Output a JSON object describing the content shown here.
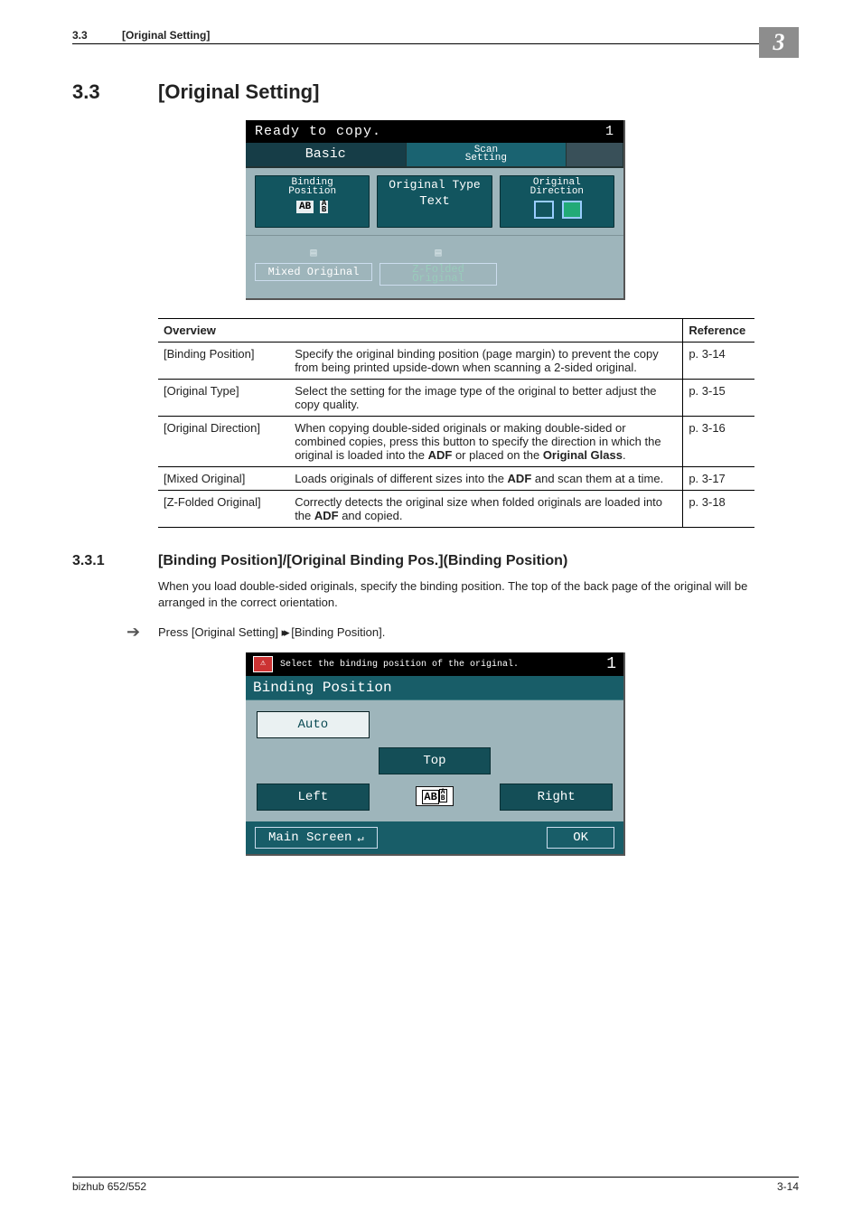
{
  "header": {
    "sec_num": "3.3",
    "sec_title": "[Original Setting]",
    "chapter": "3"
  },
  "heading": {
    "num": "3.3",
    "title": "[Original Setting]"
  },
  "panel1": {
    "status": "Ready to copy.",
    "count": "1",
    "tab_basic": "Basic",
    "tab_scan1": "Scan",
    "tab_scan2": "Setting",
    "binding_pos1": "Binding",
    "binding_pos2": "Position",
    "binding_icon": "AB A/B",
    "orig_type_label": "Original Type",
    "orig_type_value": "Text",
    "orig_dir1": "Original",
    "orig_dir2": "Direction",
    "mixed": "Mixed Original",
    "zfold1": "Z-Folded",
    "zfold2": "Original"
  },
  "table": {
    "h1": "Overview",
    "h2": "Reference",
    "rows": [
      {
        "name": "[Binding Position]",
        "desc": "Specify the original binding position (page margin) to prevent the copy from being printed upside-down when scanning a 2-sided original.",
        "ref": "p. 3-14"
      },
      {
        "name": "[Original Type]",
        "desc": "Select the setting for the image type of the original to better adjust the copy quality.",
        "ref": "p. 3-15"
      },
      {
        "name": "[Original Direction]",
        "desc_pre": "When copying double-sided originals or making double-sided or combined copies, press this button to specify the direction in which the original is loaded into the ",
        "desc_bold1": "ADF",
        "desc_mid": " or placed on the ",
        "desc_bold2": "Original Glass",
        "desc_post": ".",
        "ref": "p. 3-16"
      },
      {
        "name": "[Mixed Original]",
        "desc_pre": "Loads originals of different sizes into the ",
        "desc_bold1": "ADF",
        "desc_post": " and scan them at a time.",
        "ref": "p. 3-17"
      },
      {
        "name": "[Z-Folded Original]",
        "desc_pre": "Correctly detects the original size when folded originals are loaded into the ",
        "desc_bold1": "ADF",
        "desc_post": " and copied.",
        "ref": "p. 3-18"
      }
    ]
  },
  "sub": {
    "num": "3.3.1",
    "title": "[Binding Position]/[Original Binding Pos.](Binding Position)",
    "body": "When you load double-sided originals, specify the binding position. The top of the back page of the original will be arranged in the correct orientation.",
    "step_pre": "Press [Original Setting] ",
    "step_post": " [Binding Position]."
  },
  "panel2": {
    "prompt": "Select the binding position of the original.",
    "count": "1",
    "title": "Binding Position",
    "auto": "Auto",
    "top": "Top",
    "left": "Left",
    "right": "Right",
    "center_icon": "AB A/B",
    "main_screen": "Main Screen",
    "ok": "OK"
  },
  "footer": {
    "left": "bizhub 652/552",
    "right": "3-14"
  }
}
